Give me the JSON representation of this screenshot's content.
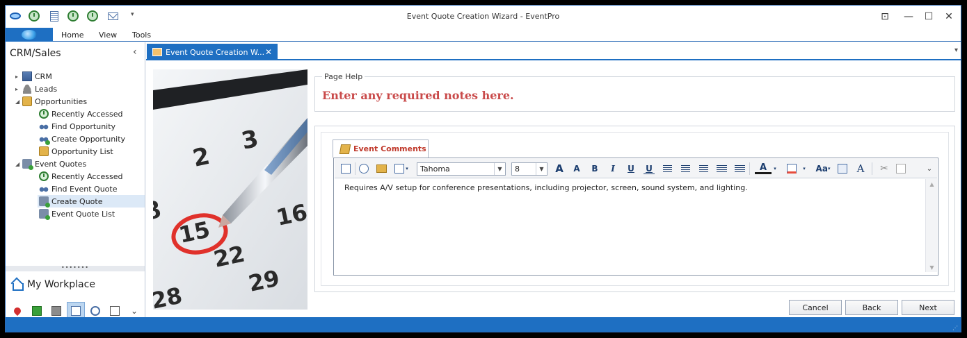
{
  "window": {
    "title": "Event Quote Creation Wizard - EventPro",
    "controls": {
      "restore": "⊡",
      "minimize": "—",
      "maximize": "☐",
      "close": "✕"
    }
  },
  "quick_access": {
    "icons": [
      "eventpro-eye-icon",
      "recently-accessed-icon",
      "document-icon",
      "clock-icon",
      "clock-icon",
      "mail-icon"
    ],
    "more": "▾"
  },
  "ribbon": {
    "tabs": [
      "Home",
      "View",
      "Tools"
    ]
  },
  "sidebar": {
    "title": "CRM/Sales",
    "collapse": "‹",
    "tree": [
      {
        "label": "CRM",
        "icon": "building-icon",
        "level": 0,
        "arrow": "▸"
      },
      {
        "label": "Leads",
        "icon": "person-icon",
        "level": 0,
        "arrow": "▸"
      },
      {
        "label": "Opportunities",
        "icon": "folder-icon",
        "level": 0,
        "arrow": "◢"
      },
      {
        "label": "Recently Accessed",
        "icon": "clock-icon",
        "level": 1
      },
      {
        "label": "Find Opportunity",
        "icon": "binoculars-icon",
        "level": 1
      },
      {
        "label": "Create Opportunity",
        "icon": "create-icon",
        "level": 1
      },
      {
        "label": "Opportunity List",
        "icon": "folder-icon",
        "level": 1
      },
      {
        "label": "Event Quotes",
        "icon": "quote-icon",
        "level": 0,
        "arrow": "◢"
      },
      {
        "label": "Recently Accessed",
        "icon": "clock-icon",
        "level": 1
      },
      {
        "label": "Find Event Quote",
        "icon": "binoculars-icon",
        "level": 1
      },
      {
        "label": "Create Quote",
        "icon": "quote-icon",
        "level": 1,
        "selected": true
      },
      {
        "label": "Event Quote List",
        "icon": "quote-icon",
        "level": 1
      }
    ],
    "splitter": "•••••••",
    "workplace": "My Workplace",
    "more": "⌄"
  },
  "doc_tab": {
    "label": "Event Quote Creation W...",
    "close": "✕",
    "menu": "▾"
  },
  "page_help": {
    "title": "Page Help",
    "text": "Enter any required notes here."
  },
  "comments": {
    "tab_label": "Event Comments",
    "font": "Tahoma",
    "size": "8",
    "text": "Requires A/V setup for conference presentations, including projector, screen, sound system, and lighting.",
    "toolbar": {
      "grow": "A",
      "shrink": "A",
      "bold": "B",
      "italic": "I",
      "underline": "U",
      "double_underline": "U",
      "font_color": "A",
      "case": "Aa",
      "clear": "A"
    },
    "scroll": {
      "up": "▲",
      "down": "▼"
    }
  },
  "buttons": {
    "cancel": "Cancel",
    "back": "Back",
    "next": "Next"
  },
  "status": {
    "grip": "⋰"
  },
  "colors": {
    "accent": "#1e6fc2",
    "help_text": "#c94a4a",
    "comments_tab": "#c0392b"
  }
}
